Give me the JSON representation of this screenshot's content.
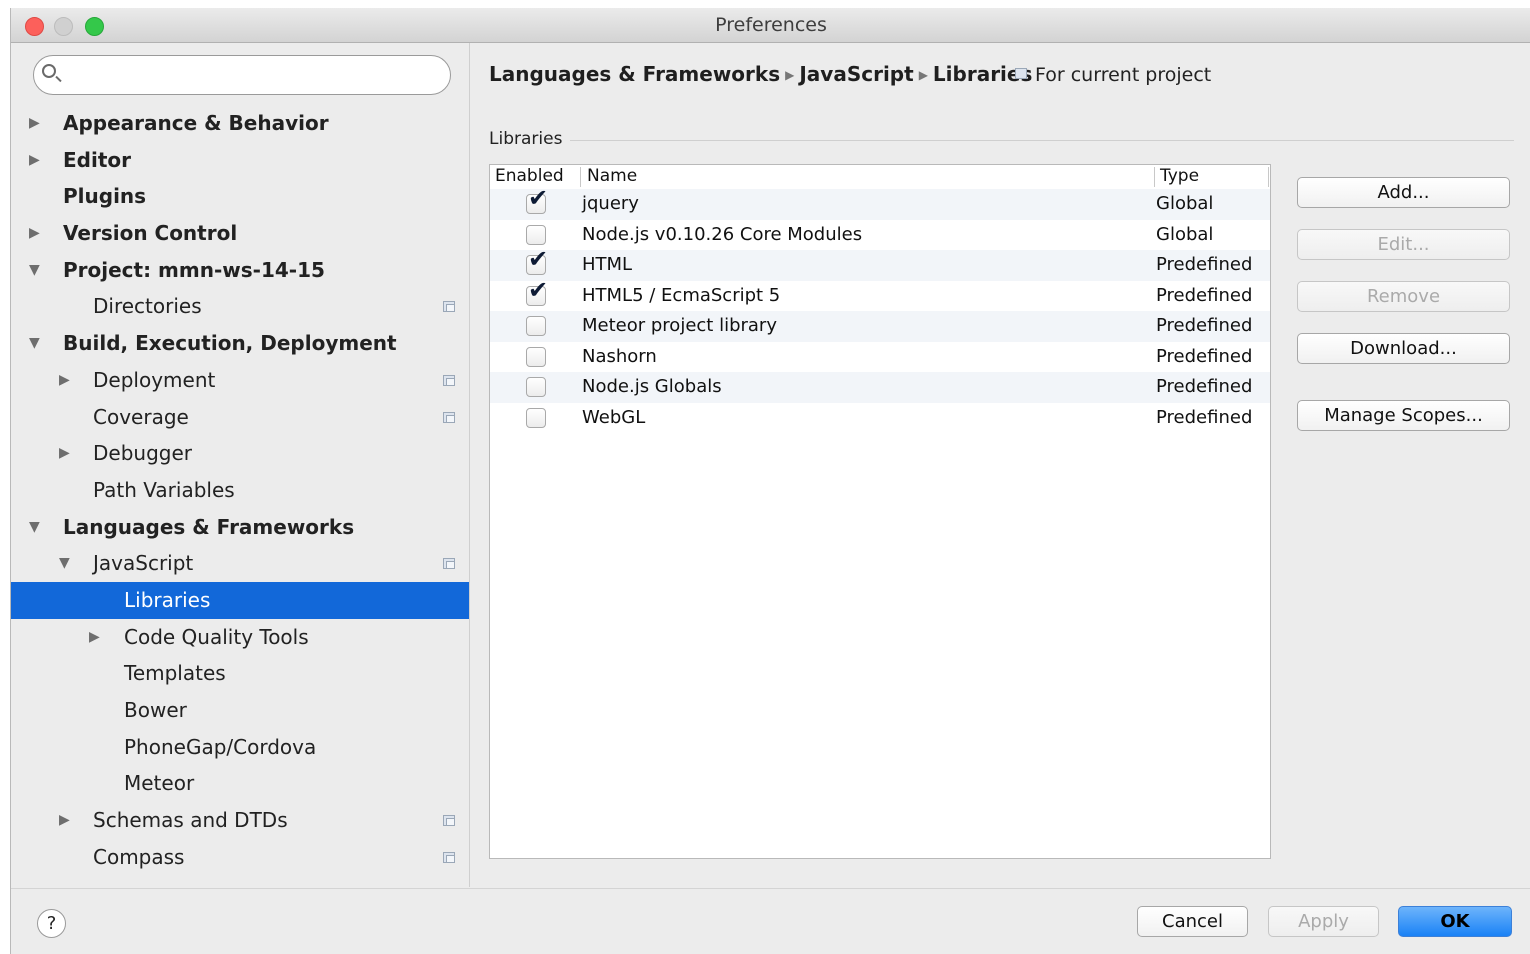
{
  "window": {
    "title": "Preferences"
  },
  "sidebar": {
    "search": {
      "value": "",
      "placeholder": ""
    },
    "items": [
      {
        "label": "Appearance & Behavior",
        "arrow": "▶",
        "level": 0,
        "bold": true
      },
      {
        "label": "Editor",
        "arrow": "▶",
        "level": 0,
        "bold": true
      },
      {
        "label": "Plugins",
        "arrow": "",
        "level": 0,
        "bold": true
      },
      {
        "label": "Version Control",
        "arrow": "▶",
        "level": 0,
        "bold": true
      },
      {
        "label": "Project: mmn-ws-14-15",
        "arrow": "▼",
        "level": 0,
        "bold": true
      },
      {
        "label": "Directories",
        "arrow": "",
        "level": 1,
        "bold": false,
        "project_icon": true
      },
      {
        "label": "Build, Execution, Deployment",
        "arrow": "▼",
        "level": 0,
        "bold": true
      },
      {
        "label": "Deployment",
        "arrow": "▶",
        "level": 1,
        "bold": false,
        "project_icon": true
      },
      {
        "label": "Coverage",
        "arrow": "",
        "level": 1,
        "bold": false,
        "project_icon": true
      },
      {
        "label": "Debugger",
        "arrow": "▶",
        "level": 1,
        "bold": false
      },
      {
        "label": "Path Variables",
        "arrow": "",
        "level": 1,
        "bold": false
      },
      {
        "label": "Languages & Frameworks",
        "arrow": "▼",
        "level": 0,
        "bold": true
      },
      {
        "label": "JavaScript",
        "arrow": "▼",
        "level": 1,
        "bold": false,
        "project_icon": true
      },
      {
        "label": "Libraries",
        "arrow": "",
        "level": 2,
        "bold": false,
        "selected": true
      },
      {
        "label": "Code Quality Tools",
        "arrow": "▶",
        "level": 2,
        "bold": false
      },
      {
        "label": "Templates",
        "arrow": "",
        "level": 2,
        "bold": false
      },
      {
        "label": "Bower",
        "arrow": "",
        "level": 2,
        "bold": false
      },
      {
        "label": "PhoneGap/Cordova",
        "arrow": "",
        "level": 2,
        "bold": false
      },
      {
        "label": "Meteor",
        "arrow": "",
        "level": 2,
        "bold": false
      },
      {
        "label": "Schemas and DTDs",
        "arrow": "▶",
        "level": 1,
        "bold": false,
        "project_icon": true
      },
      {
        "label": "Compass",
        "arrow": "",
        "level": 1,
        "bold": false,
        "project_icon": true
      }
    ]
  },
  "content": {
    "breadcrumb": [
      "Languages & Frameworks",
      "JavaScript",
      "Libraries"
    ],
    "breadcrumb_separator": "▶",
    "scope_note": "For current project",
    "group_title": "Libraries",
    "table": {
      "columns": [
        "Enabled",
        "Name",
        "Type"
      ],
      "rows": [
        {
          "enabled": true,
          "name": "jquery",
          "type": "Global"
        },
        {
          "enabled": false,
          "name": "Node.js v0.10.26 Core Modules",
          "type": "Global"
        },
        {
          "enabled": true,
          "name": "HTML",
          "type": "Predefined"
        },
        {
          "enabled": true,
          "name": "HTML5 / EcmaScript 5",
          "type": "Predefined"
        },
        {
          "enabled": false,
          "name": "Meteor project library",
          "type": "Predefined"
        },
        {
          "enabled": false,
          "name": "Nashorn",
          "type": "Predefined"
        },
        {
          "enabled": false,
          "name": "Node.js Globals",
          "type": "Predefined"
        },
        {
          "enabled": false,
          "name": "WebGL",
          "type": "Predefined"
        }
      ]
    },
    "buttons": {
      "add": "Add...",
      "edit": "Edit...",
      "remove": "Remove",
      "download": "Download...",
      "manage_scopes": "Manage Scopes..."
    }
  },
  "footer": {
    "help": "?",
    "cancel": "Cancel",
    "apply": "Apply",
    "ok": "OK"
  },
  "colors": {
    "selection": "#1268d9",
    "primary_button": "#1a82f6",
    "window_bg": "#ececec"
  }
}
